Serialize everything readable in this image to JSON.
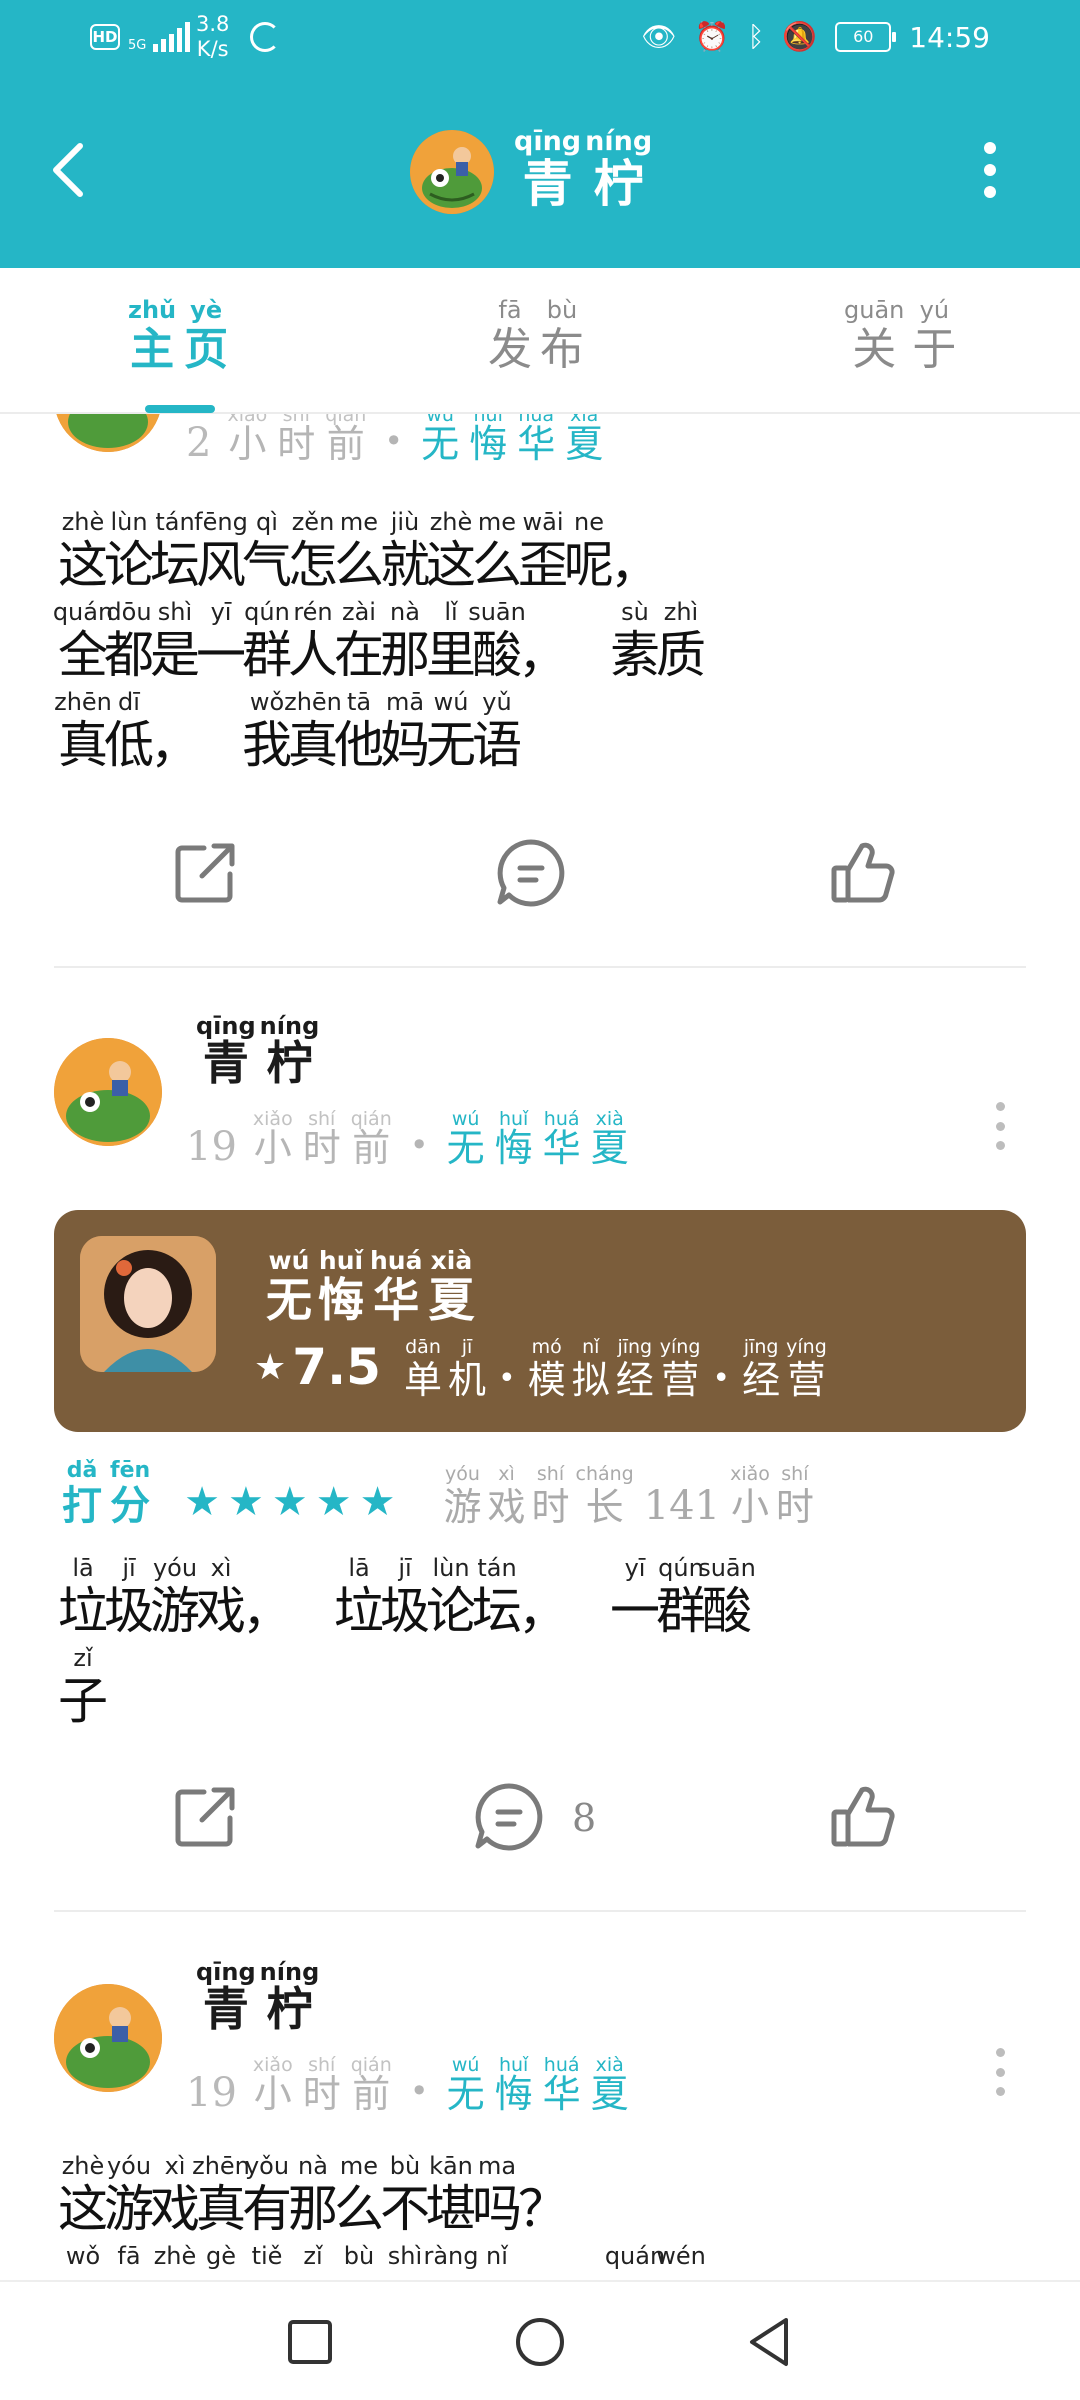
{
  "status_bar": {
    "hd": "HD",
    "network": "5G",
    "speed_value": "3.8",
    "speed_unit": "K/s",
    "battery": "60",
    "time": "14:59"
  },
  "header": {
    "title_pinyin": [
      "qīng",
      "níng"
    ],
    "title": [
      "青",
      "柠"
    ]
  },
  "tabs": [
    {
      "pinyin": [
        "zhǔ",
        "yè"
      ],
      "label": [
        "主",
        "页"
      ],
      "active": true
    },
    {
      "pinyin": [
        "fā",
        "bù"
      ],
      "label": [
        "发",
        "布"
      ],
      "active": false
    },
    {
      "pinyin": [
        "guān",
        "yú"
      ],
      "label": [
        "关",
        "于"
      ],
      "active": false
    }
  ],
  "post1": {
    "time_num": "2",
    "time_py": [
      "xiǎo",
      "shí",
      "qián"
    ],
    "time_hz": [
      "小",
      "时",
      "前"
    ],
    "game_py": [
      "wú",
      "huǐ",
      "huá",
      "xià"
    ],
    "game_hz": [
      "无",
      "悔",
      "华",
      "夏"
    ],
    "lines": [
      [
        [
          "zhè",
          "这"
        ],
        [
          "lùn",
          "论"
        ],
        [
          "tán",
          "坛"
        ],
        [
          "fēng",
          "风"
        ],
        [
          "qì",
          "气"
        ],
        [
          "zěn",
          "怎"
        ],
        [
          "me",
          "么"
        ],
        [
          "jiù",
          "就"
        ],
        [
          "zhè",
          "这"
        ],
        [
          "me",
          "么"
        ],
        [
          "wāi",
          "歪"
        ],
        [
          "ne",
          "呢"
        ],
        [
          "",
          "，"
        ]
      ],
      [
        [
          "quán",
          "全"
        ],
        [
          "dōu",
          "都"
        ],
        [
          "shì",
          "是"
        ],
        [
          "yī",
          "一"
        ],
        [
          "qún",
          "群"
        ],
        [
          "rén",
          "人"
        ],
        [
          "zài",
          "在"
        ],
        [
          "nà",
          "那"
        ],
        [
          "lǐ",
          "里"
        ],
        [
          "suān",
          "酸"
        ],
        [
          "",
          "，"
        ],
        [
          "",
          ""
        ],
        [
          "sù",
          "素"
        ],
        [
          "zhì",
          "质"
        ]
      ],
      [
        [
          "zhēn",
          "真"
        ],
        [
          "dī",
          "低"
        ],
        [
          "",
          "，"
        ],
        [
          "",
          ""
        ],
        [
          "wǒ",
          "我"
        ],
        [
          "zhēn",
          "真"
        ],
        [
          "tā",
          "他"
        ],
        [
          "mā",
          "妈"
        ],
        [
          "wú",
          "无"
        ],
        [
          "yǔ",
          "语"
        ]
      ]
    ]
  },
  "post2": {
    "user_py": [
      "qīng",
      "níng"
    ],
    "user": [
      "青",
      "柠"
    ],
    "time_num": "19",
    "time_py": [
      "xiǎo",
      "shí",
      "qián"
    ],
    "time_hz": [
      "小",
      "时",
      "前"
    ],
    "game_py": [
      "wú",
      "huǐ",
      "huá",
      "xià"
    ],
    "game_hz": [
      "无",
      "悔",
      "华",
      "夏"
    ],
    "card": {
      "title_py": [
        "wú",
        "huǐ",
        "huá",
        "xià"
      ],
      "title": [
        "无",
        "悔",
        "华",
        "夏"
      ],
      "score": "7.5",
      "tags": [
        {
          "py": [
            "dān",
            "jī"
          ],
          "hz": [
            "单",
            "机"
          ]
        },
        {
          "py": [
            "mó",
            "nǐ",
            "jīng",
            "yíng"
          ],
          "hz": [
            "模",
            "拟",
            "经",
            "营"
          ]
        },
        {
          "py": [
            "jīng",
            "yíng"
          ],
          "hz": [
            "经",
            "营"
          ]
        }
      ]
    },
    "rating_py": [
      "dǎ",
      "fēn"
    ],
    "rating": [
      "打",
      "分"
    ],
    "stars": 5,
    "play_py": [
      "yóu",
      "xì",
      "shí",
      "cháng"
    ],
    "play": [
      "游",
      "戏",
      "时",
      "长"
    ],
    "play_hours": "141",
    "play_unit_py": [
      "xiǎo",
      "shí"
    ],
    "play_unit": [
      "小",
      "时"
    ],
    "lines": [
      [
        [
          "lā",
          "垃"
        ],
        [
          "jī",
          "圾"
        ],
        [
          "yóu",
          "游"
        ],
        [
          "xì",
          "戏"
        ],
        [
          "",
          "，"
        ],
        [
          "",
          ""
        ],
        [
          "lā",
          "垃"
        ],
        [
          "jī",
          "圾"
        ],
        [
          "lùn",
          "论"
        ],
        [
          "tán",
          "坛"
        ],
        [
          "",
          "，"
        ],
        [
          "",
          ""
        ],
        [
          "yī",
          "一"
        ],
        [
          "qún",
          "群"
        ],
        [
          "suān",
          "酸"
        ]
      ],
      [
        [
          "zǐ",
          "子"
        ]
      ]
    ],
    "comment_count": "8"
  },
  "post3": {
    "user_py": [
      "qīng",
      "níng"
    ],
    "user": [
      "青",
      "柠"
    ],
    "time_num": "19",
    "time_py": [
      "xiǎo",
      "shí",
      "qián"
    ],
    "time_hz": [
      "小",
      "时",
      "前"
    ],
    "game_py": [
      "wú",
      "huǐ",
      "huá",
      "xià"
    ],
    "game_hz": [
      "无",
      "悔",
      "华",
      "夏"
    ],
    "lines": [
      [
        [
          "zhè",
          "这"
        ],
        [
          "yóu",
          "游"
        ],
        [
          "xì",
          "戏"
        ],
        [
          "zhēn",
          "真"
        ],
        [
          "yǒu",
          "有"
        ],
        [
          "nà",
          "那"
        ],
        [
          "me",
          "么"
        ],
        [
          "bù",
          "不"
        ],
        [
          "kān",
          "堪"
        ],
        [
          "ma",
          "吗"
        ],
        [
          "",
          "？"
        ]
      ],
      [
        [
          "wǒ",
          ""
        ],
        [
          "fā",
          ""
        ],
        [
          "zhè",
          ""
        ],
        [
          "gè",
          ""
        ],
        [
          "tiě",
          ""
        ],
        [
          "zǐ",
          ""
        ],
        [
          "bù",
          ""
        ],
        [
          "shì",
          ""
        ],
        [
          "ràng",
          ""
        ],
        [
          "nǐ",
          ""
        ],
        [
          "",
          ""
        ],
        [
          "",
          ""
        ],
        [
          "quán",
          ""
        ],
        [
          "wén",
          ""
        ]
      ]
    ]
  }
}
